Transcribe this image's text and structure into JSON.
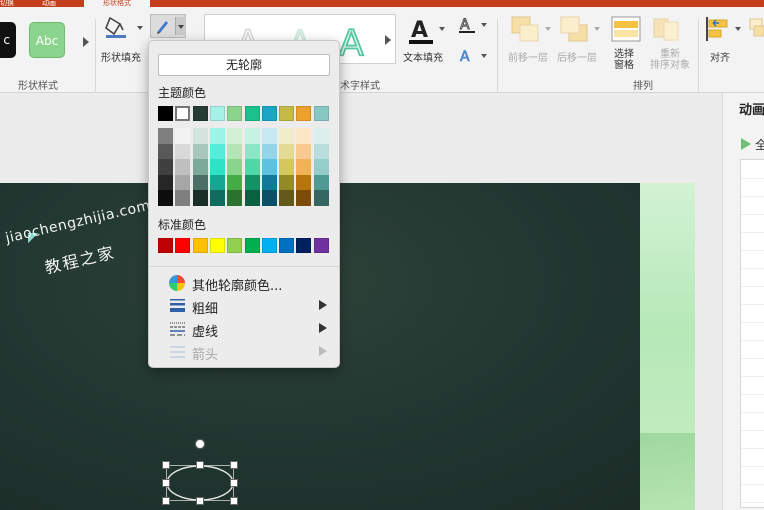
{
  "ribbon": {
    "tabs": [
      {
        "label": "切换"
      },
      {
        "label": "动画"
      },
      {
        "label": "形状格式"
      }
    ],
    "style_preview_text": "Abc",
    "shape_fill_label": "形状填充",
    "shape_styles_group": "形状样式",
    "wordart_group": "艺术字样式",
    "text_fill_label": "文本填充",
    "bring_forward": "前移一层",
    "send_backward": "后移一层",
    "selection_pane": "选择\n窗格",
    "reorder": "重新\n排序对象",
    "align": "对齐",
    "arrange_group": "排列",
    "accent_color": "#c43e1c"
  },
  "panel": {
    "title": "动画",
    "play_all": "全"
  },
  "dropdown": {
    "no_outline": "无轮廓",
    "theme_colors_title": "主题颜色",
    "theme_colors": [
      "#000000",
      "#ffffff",
      "#253d34",
      "#a6f1e6",
      "#8bd48d",
      "#19c28a",
      "#1aa5c9",
      "#c5ba47",
      "#eda02c",
      "#88c8c2"
    ],
    "theme_shades": [
      [
        "#7f7f7f",
        "#595959",
        "#404040",
        "#262626",
        "#0d0d0d"
      ],
      [
        "#f2f2f2",
        "#d9d9d9",
        "#bfbfbf",
        "#a6a6a6",
        "#7f7f7f"
      ],
      [
        "#d3e3dd",
        "#a7c6bc",
        "#7ba99a",
        "#4b6f64",
        "#1b2f28"
      ],
      [
        "#9af5e6",
        "#56ecd9",
        "#2fe2c6",
        "#17a692",
        "#0d6d5f"
      ],
      [
        "#d3f0d4",
        "#b5e5b6",
        "#8bd48d",
        "#45ac48",
        "#2d7330"
      ],
      [
        "#c6f2e2",
        "#8ce6c5",
        "#4dd8a6",
        "#139265",
        "#0c6042"
      ],
      [
        "#c7e9f4",
        "#94d5ea",
        "#5ec1e0",
        "#12799a",
        "#0b5066"
      ],
      [
        "#f1ecc9",
        "#e3da94",
        "#d5c75e",
        "#958a28",
        "#63591b"
      ],
      [
        "#fbe5c7",
        "#f8ca90",
        "#f3b158",
        "#b8750d",
        "#7b4d08"
      ],
      [
        "#dbeeec",
        "#b9ddda",
        "#95cdc8",
        "#4f9b94",
        "#356762"
      ]
    ],
    "standard_colors_title": "标准颜色",
    "standard_colors": [
      "#c00000",
      "#ff0000",
      "#ffc000",
      "#ffff00",
      "#92d050",
      "#00b050",
      "#00b0f0",
      "#0070c0",
      "#002060",
      "#7030a0"
    ],
    "more_colors": "其他轮廓颜色...",
    "weight": "粗细",
    "dashes": "虚线",
    "arrows": "箭头"
  },
  "watermark": {
    "line1": "jiaochengzhijia.com",
    "line2": "教程之家"
  }
}
